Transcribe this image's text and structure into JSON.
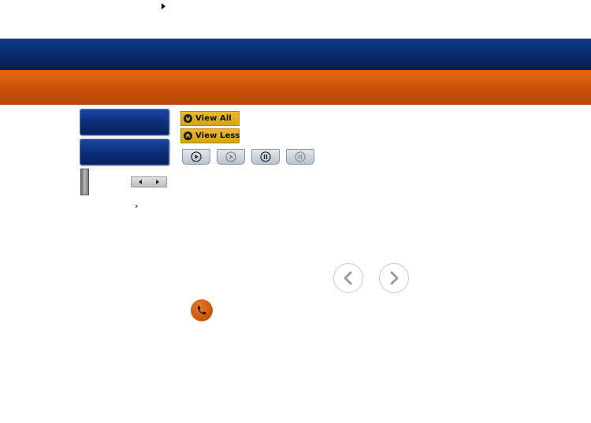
{
  "top": {
    "arrow_icon": "caret-right-icon"
  },
  "header": {
    "band_colors": {
      "blue": "#0a2a6a",
      "orange": "#c95208"
    }
  },
  "sidebar": {
    "menu_buttons": [
      {
        "label": ""
      },
      {
        "label": ""
      }
    ],
    "slider_arrows": [
      "arrow-left-icon",
      "arrow-right-icon"
    ],
    "chevron": "›"
  },
  "controls": {
    "view_all_label": "View All",
    "view_less_label": "View Less",
    "view_all_icon": "chevron-down-circle-icon",
    "view_less_icon": "chevron-up-circle-icon",
    "playback_buttons": [
      {
        "icon": "play-icon",
        "state": "active"
      },
      {
        "icon": "play-icon",
        "state": "disabled"
      },
      {
        "icon": "pause-icon",
        "state": "active"
      },
      {
        "icon": "pause-icon",
        "state": "disabled"
      }
    ],
    "accent_color": "#d4a414"
  },
  "carousel": {
    "prev_icon": "chevron-left-icon",
    "next_icon": "chevron-right-icon"
  },
  "contact": {
    "icon": "phone-icon",
    "color": "#c5550a"
  }
}
